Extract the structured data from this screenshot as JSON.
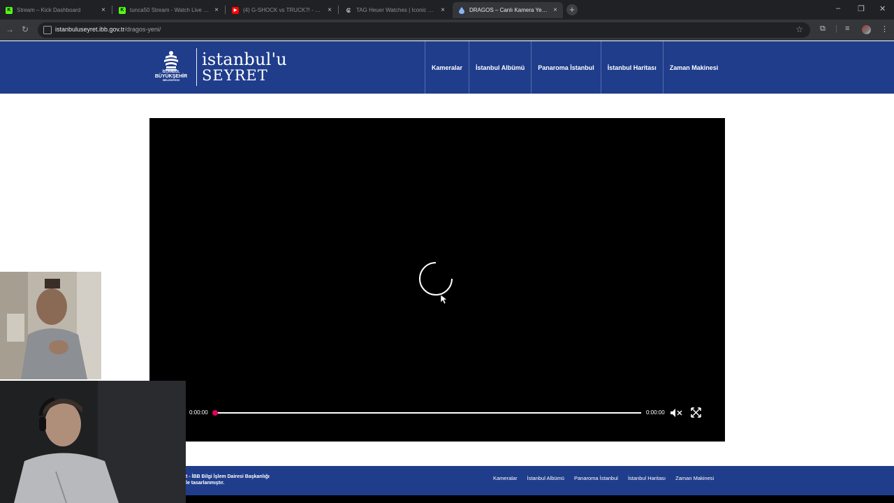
{
  "browser": {
    "tabs": [
      {
        "title": "Stream – Kick Dashboard",
        "favicon": "kick-icon",
        "active": false
      },
      {
        "title": "tunca50 Stream - Watch Live o…",
        "favicon": "kick-icon",
        "active": false
      },
      {
        "title": "(4) G-SHOCK vs TRUCK?! - You…",
        "favicon": "youtube-icon",
        "active": false
      },
      {
        "title": "TAG Heuer Watches | Iconic Sw…",
        "favicon": "tag-heuer-icon",
        "active": false
      },
      {
        "title": "DRAGOS – Canlı Kamera Yeni –",
        "favicon": "drop-icon",
        "active": true
      }
    ],
    "new_tab": "+",
    "url_host": "istanbuluseyret.ibb.gov.tr",
    "url_path": "/dragos-yeni/"
  },
  "site": {
    "logo_emblem_line1": "İSTANBUL",
    "logo_emblem_line2": "BÜYÜKŞEHİR",
    "logo_emblem_line3": "BELEDİYESİ",
    "logo_title_line1": "istanbul'u",
    "logo_title_line2": "SEYRET",
    "nav": [
      {
        "label": "Kameralar"
      },
      {
        "label": "İstanbul Albümü"
      },
      {
        "label": "Panaroma İstanbul"
      },
      {
        "label": "İstanbul Haritası"
      },
      {
        "label": "Zaman Makinesi"
      }
    ]
  },
  "player": {
    "current_time": "0:00:00",
    "duration": "0:00:00",
    "progress": 0,
    "muted": true,
    "state": "loading",
    "accent_color": "#e0005a"
  },
  "footer": {
    "credit_line1": "t - İBB Bilgi İşlem Dairesi Başkanlığı",
    "credit_line2": "le tasarlanmıştır.",
    "nav": [
      {
        "label": "Kameralar"
      },
      {
        "label": "İstanbul Albümü"
      },
      {
        "label": "Panaroma İstanbul"
      },
      {
        "label": "İstanbul Haritası"
      },
      {
        "label": "Zaman Makinesi"
      }
    ]
  },
  "colors": {
    "header_blue": "#1f3d8b",
    "browser_dark": "#202124"
  }
}
